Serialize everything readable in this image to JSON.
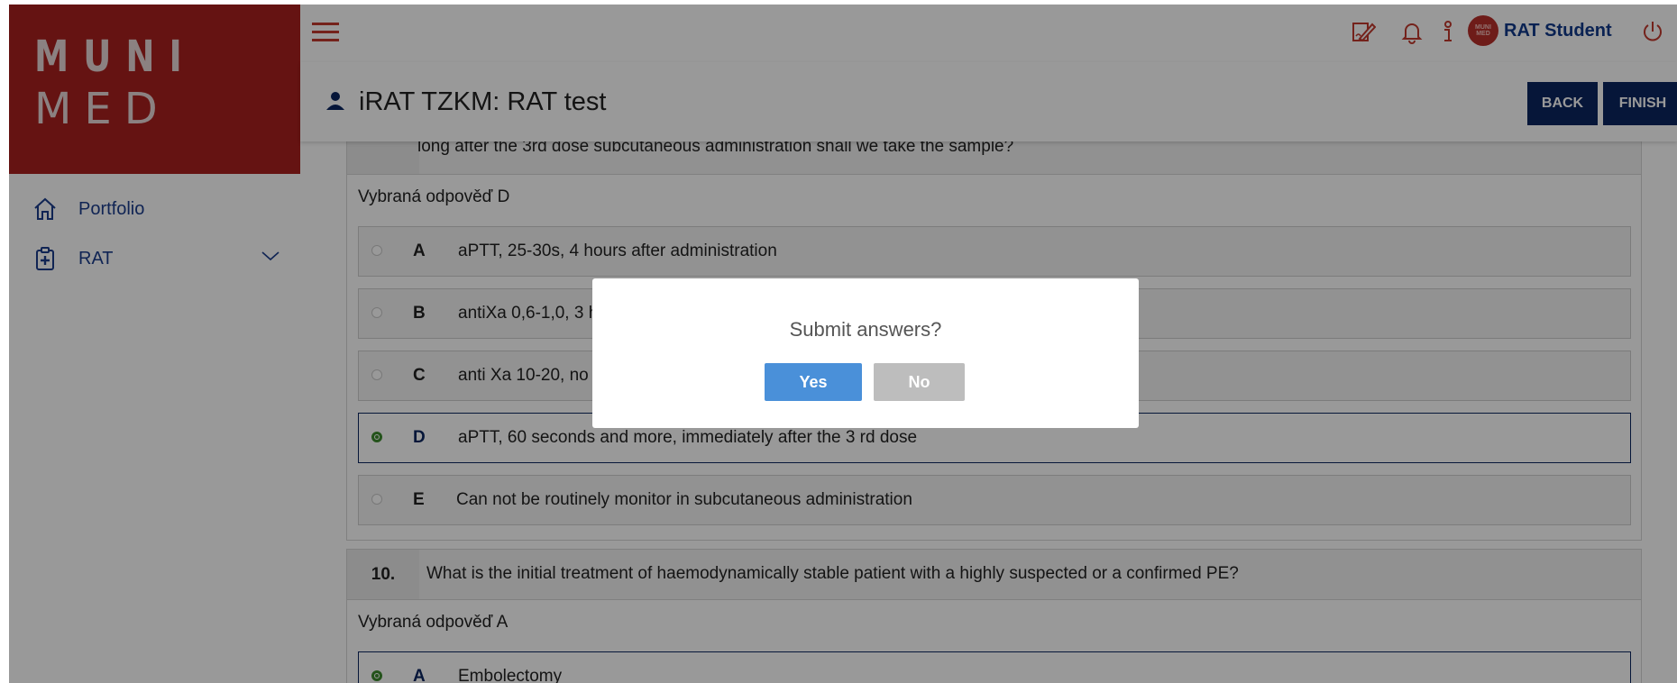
{
  "brand": {
    "line1": "MUNI",
    "line2": "MED"
  },
  "sidebar": {
    "items": [
      {
        "label": "Portfolio",
        "icon": "home-icon"
      },
      {
        "label": "RAT",
        "icon": "clipboard-plus-icon",
        "expandable": true
      }
    ]
  },
  "topbar": {
    "icons": [
      "sign-pen-icon",
      "bell-icon",
      "info-icon",
      "power-icon"
    ],
    "user": {
      "name": "RAT Student",
      "avatar_text": "MUNI MED"
    }
  },
  "page": {
    "title": "iRAT TZKM: RAT test",
    "back_label": "BACK",
    "finish_label": "FINISH"
  },
  "questions": [
    {
      "partial_text": "long after the 3rd dose subcutaneous administration shall we take the sample?",
      "selected_label": "Vybraná odpověď D",
      "options": [
        {
          "letter": "A",
          "text": "aPTT, 25-30s, 4 hours after administration",
          "selected": false
        },
        {
          "letter": "B",
          "text": "antiXa 0,6-1,0, 3 h",
          "selected": false
        },
        {
          "letter": "C",
          "text": "anti Xa 10-20, no",
          "selected": false
        },
        {
          "letter": "D",
          "text": "aPTT, 60 seconds and more, immediately after the 3 rd dose",
          "selected": true
        },
        {
          "letter": "E",
          "text": "Can not be routinely monitor in subcutaneous administration",
          "selected": false
        }
      ]
    },
    {
      "number": "10.",
      "text": "What is the initial treatment of haemodynamically stable patient with a highly suspected or a confirmed PE?",
      "selected_label": "Vybraná odpověď A",
      "options": [
        {
          "letter": "A",
          "text": "Embolectomy",
          "selected": true
        }
      ]
    }
  ],
  "dialog": {
    "title": "Submit answers?",
    "yes_label": "Yes",
    "no_label": "No"
  },
  "colors": {
    "brand_red": "#a8201e",
    "navy": "#0b2560",
    "yes_blue": "#4a90d9",
    "no_gray": "#bdbdbd",
    "selected_green": "#3c8a2e"
  }
}
